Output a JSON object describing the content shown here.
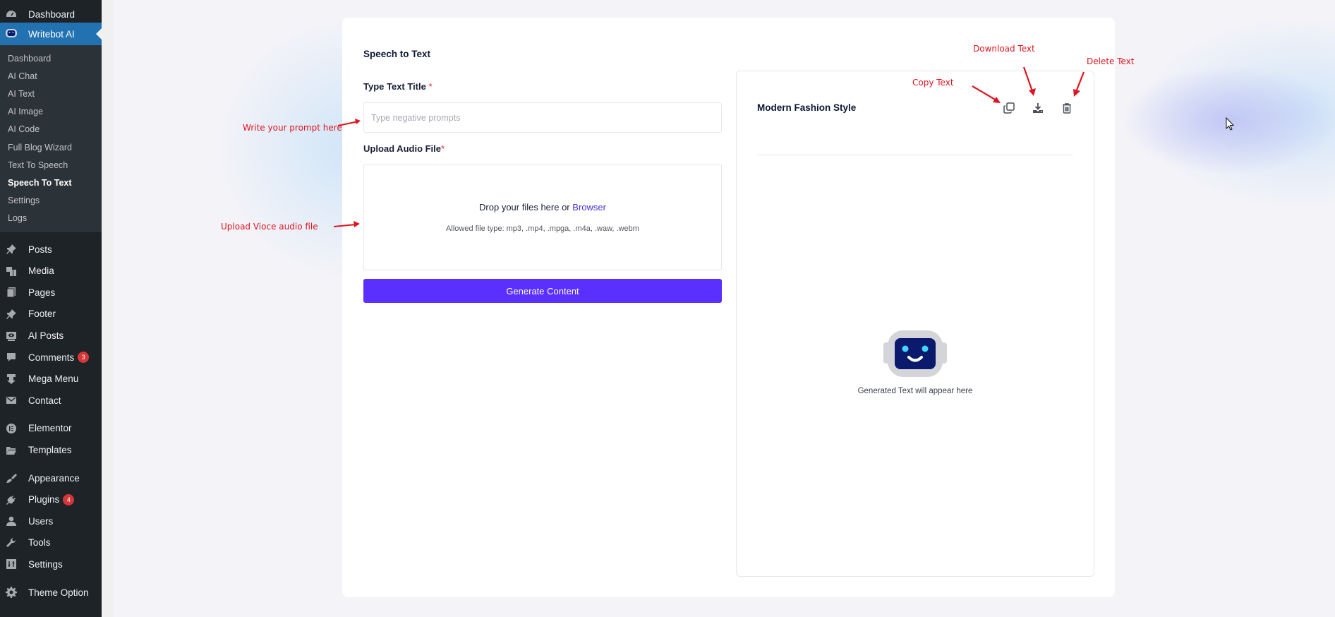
{
  "sidebar": {
    "top_item": {
      "label": "Dashboard",
      "icon": "dashboard-icon"
    },
    "active_item": {
      "label": "Writebot AI",
      "icon": "robot-icon"
    },
    "submenu": [
      {
        "label": "Dashboard",
        "current": false
      },
      {
        "label": "AI Chat",
        "current": false
      },
      {
        "label": "AI Text",
        "current": false
      },
      {
        "label": "AI Image",
        "current": false
      },
      {
        "label": "AI Code",
        "current": false
      },
      {
        "label": "Full Blog Wizard",
        "current": false
      },
      {
        "label": "Text To Speech",
        "current": false
      },
      {
        "label": "Speech To Text",
        "current": true
      },
      {
        "label": "Settings",
        "current": false
      },
      {
        "label": "Logs",
        "current": false
      }
    ],
    "items": [
      {
        "label": "Posts",
        "icon": "pin-icon"
      },
      {
        "label": "Media",
        "icon": "media-icon"
      },
      {
        "label": "Pages",
        "icon": "pages-icon"
      },
      {
        "label": "Footer",
        "icon": "pin-icon"
      },
      {
        "label": "AI Posts",
        "icon": "monitor-eye-icon"
      },
      {
        "label": "Comments",
        "icon": "comment-icon",
        "badge": "3"
      },
      {
        "label": "Mega Menu",
        "icon": "mega-menu-icon"
      },
      {
        "label": "Contact",
        "icon": "mail-icon"
      },
      {
        "label": "Elementor",
        "icon": "elementor-icon"
      },
      {
        "label": "Templates",
        "icon": "folder-icon"
      },
      {
        "label": "Appearance",
        "icon": "brush-icon"
      },
      {
        "label": "Plugins",
        "icon": "plugin-icon",
        "badge": "4"
      },
      {
        "label": "Users",
        "icon": "user-icon"
      },
      {
        "label": "Tools",
        "icon": "wrench-icon"
      },
      {
        "label": "Settings",
        "icon": "settings-icon"
      },
      {
        "label": "Theme Option",
        "icon": "gear-icon"
      }
    ]
  },
  "form": {
    "title": "Speech to Text",
    "title_field": {
      "label": "Type Text Title",
      "required_mark": "*",
      "value": "",
      "placeholder": "Type negative prompts"
    },
    "audio_field": {
      "label": "Upload Audio File",
      "required_mark": "*",
      "drop_text": "Drop your files here or",
      "browse_link": "Browser",
      "allowed_types": "Allowed file type: mp3, .mp4, .mpga, .m4a, .waw, .webm"
    },
    "generate_button": "Generate Content"
  },
  "output": {
    "title": "Modern Fashion Style",
    "actions": [
      {
        "name": "copy",
        "icon": "copy-icon"
      },
      {
        "name": "download",
        "icon": "download-icon"
      },
      {
        "name": "delete",
        "icon": "trash-icon"
      }
    ],
    "placeholder_text": "Generated Text will appear here"
  },
  "annotations": {
    "write_prompt": "Write your prompt here",
    "upload_audio": "Upload Vioce audio file",
    "copy_text": "Copy Text",
    "download_text": "Download Text",
    "delete_text": "Delete Text"
  },
  "colors": {
    "primary": "#5930ff",
    "link": "#4f2ed8",
    "sidebar_bg": "#1d2327",
    "sidebar_active": "#2271b1",
    "annotation": "#e0141e",
    "badge": "#d63638"
  }
}
